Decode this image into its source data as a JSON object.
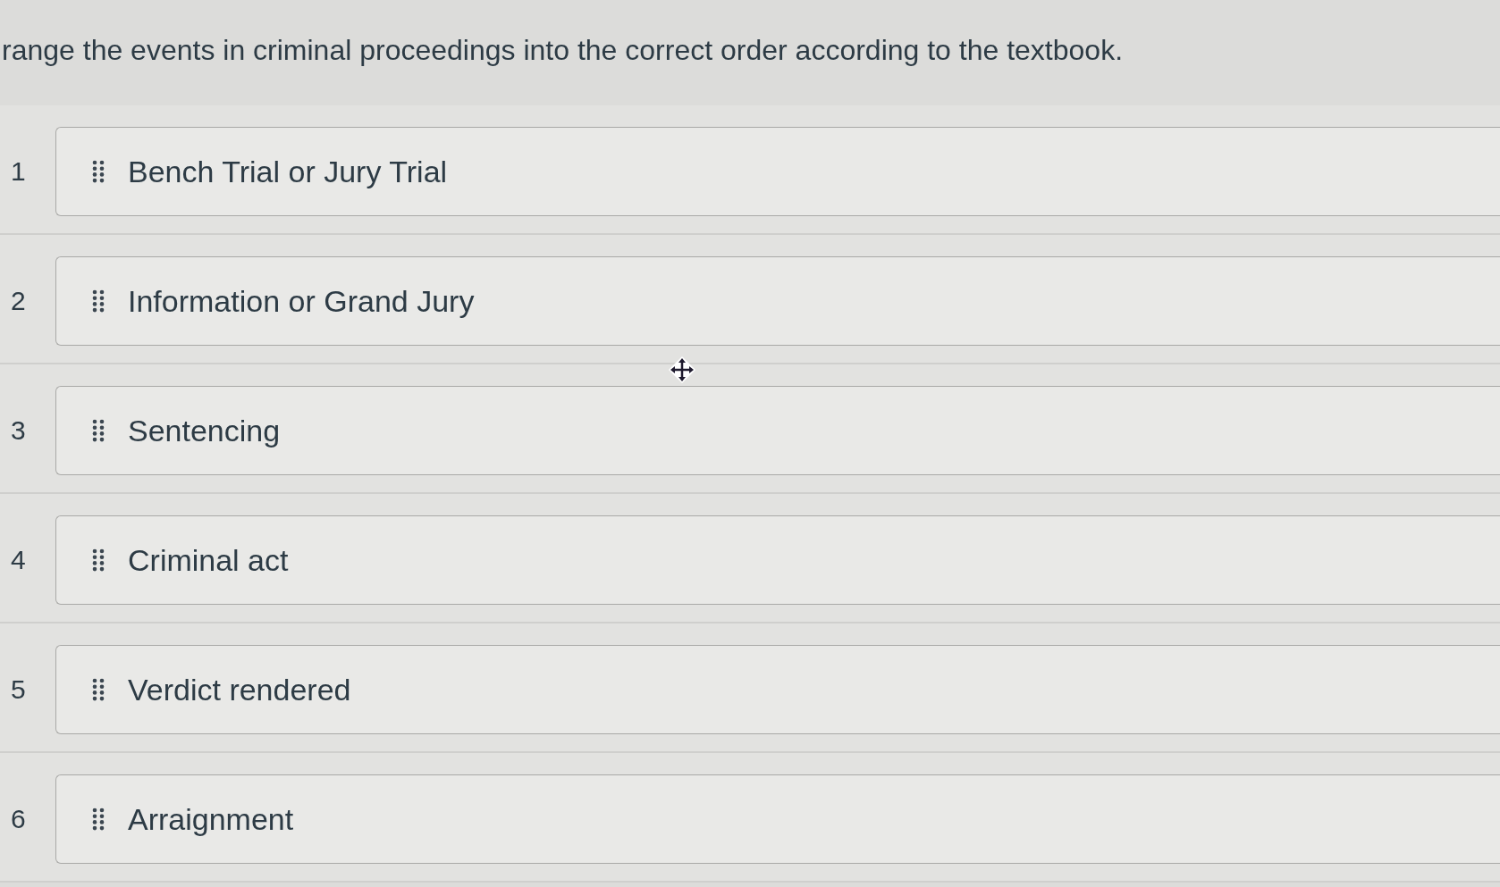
{
  "question": "range the events in criminal proceedings into the correct order according to the textbook.",
  "items": [
    {
      "number": "1",
      "label": "Bench Trial or Jury Trial"
    },
    {
      "number": "2",
      "label": "Information or Grand Jury"
    },
    {
      "number": "3",
      "label": "Sentencing"
    },
    {
      "number": "4",
      "label": "Criminal act"
    },
    {
      "number": "5",
      "label": "Verdict rendered"
    },
    {
      "number": "6",
      "label": "Arraignment"
    }
  ]
}
